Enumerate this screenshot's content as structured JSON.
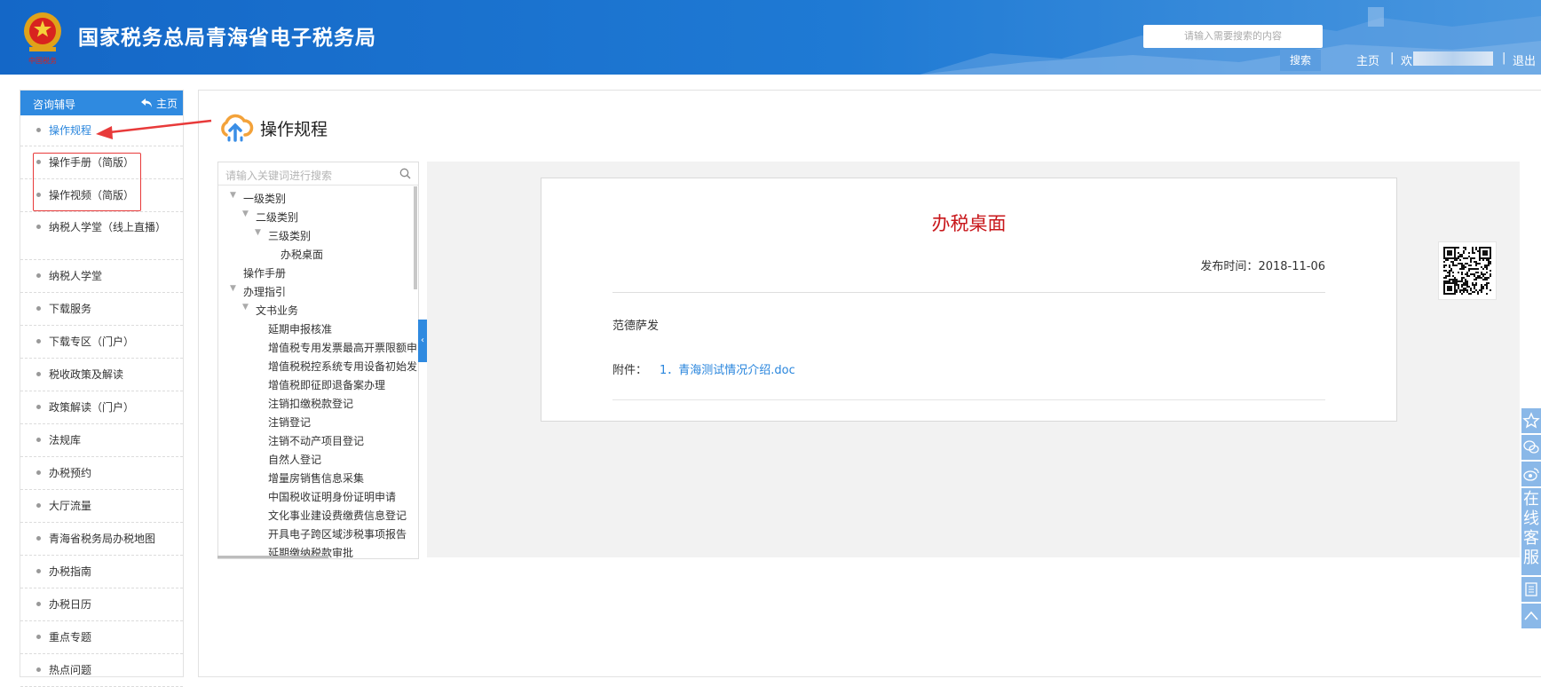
{
  "header": {
    "site_title": "国家税务总局青海省电子税务局",
    "emblem_caption": "中国税务",
    "search_placeholder": "请输入需要搜索的内容",
    "search_button": "搜索",
    "nav": {
      "home": "主页",
      "separator": "|",
      "welcome": "欢",
      "logout": "退出"
    }
  },
  "sidebar": {
    "title": "咨询辅导",
    "home_link": "主页",
    "items": [
      {
        "label": "操作规程",
        "active": true
      },
      {
        "label": "操作手册（简版）"
      },
      {
        "label": "操作视频（简版）"
      },
      {
        "label": "纳税人学堂（线上直播）"
      },
      {
        "label": "纳税人学堂"
      },
      {
        "label": "下载服务"
      },
      {
        "label": "下载专区（门户）"
      },
      {
        "label": "税收政策及解读"
      },
      {
        "label": "政策解读（门户）"
      },
      {
        "label": "法规库"
      },
      {
        "label": "办税预约"
      },
      {
        "label": "大厅流量"
      },
      {
        "label": "青海省税务局办税地图"
      },
      {
        "label": "办税指南"
      },
      {
        "label": "办税日历"
      },
      {
        "label": "重点专题"
      },
      {
        "label": "热点问题"
      }
    ]
  },
  "page": {
    "title": "操作规程"
  },
  "tree": {
    "search_placeholder": "请输入关键词进行搜索",
    "nodes": [
      {
        "label": "一级类别",
        "expanded": true
      },
      {
        "label": "二级类别",
        "expanded": true
      },
      {
        "label": "三级类别",
        "expanded": true
      },
      {
        "label": "办税桌面"
      },
      {
        "label": "操作手册"
      },
      {
        "label": "办理指引",
        "expanded": true
      },
      {
        "label": "文书业务",
        "expanded": true
      },
      {
        "label": "延期申报核准"
      },
      {
        "label": "增值税专用发票最高开票限额申"
      },
      {
        "label": "增值税税控系统专用设备初始发"
      },
      {
        "label": "增值税即征即退备案办理"
      },
      {
        "label": "注销扣缴税款登记"
      },
      {
        "label": "注销登记"
      },
      {
        "label": "注销不动产项目登记"
      },
      {
        "label": "自然人登记"
      },
      {
        "label": "增量房销售信息采集"
      },
      {
        "label": "中国税收证明身份证明申请"
      },
      {
        "label": "文化事业建设费缴费信息登记"
      },
      {
        "label": "开具电子跨区域涉税事项报告"
      },
      {
        "label": "延期缴纳税款审批"
      }
    ]
  },
  "document": {
    "title": "办税桌面",
    "publish_label": "发布时间：",
    "publish_date": "2018-11-06",
    "body": "范德萨发",
    "attachment_label": "附件：",
    "attachment_link": "1．青海测试情况介绍.doc"
  },
  "floating_tools": {
    "online_service": [
      "在",
      "线",
      "客",
      "服"
    ]
  },
  "colors": {
    "header_blue": "#1467c7",
    "accent_blue": "#2f8ae0",
    "doc_title_red": "#c8171b",
    "annotation_red": "#e83a3a"
  },
  "icons": [
    "emblem-icon",
    "back-arrow-icon",
    "cloud-upload-icon",
    "search-icon",
    "tree-collapse-arrow-icon",
    "qr-code-icon",
    "star-icon",
    "wechat-icon",
    "weibo-icon",
    "list-icon",
    "back-to-top-icon"
  ]
}
